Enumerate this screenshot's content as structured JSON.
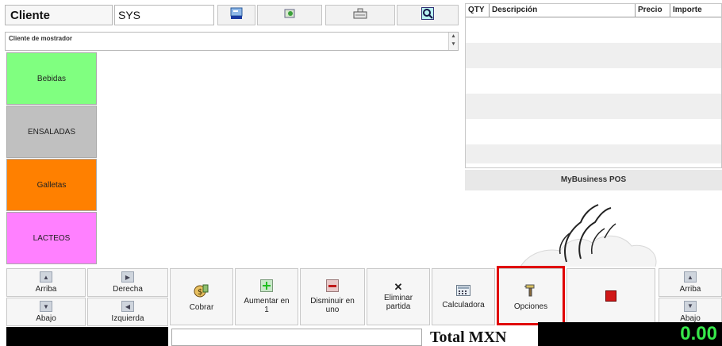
{
  "header": {
    "client_label": "Cliente",
    "client_code": "SYS",
    "client_name": "Cliente de mostrador",
    "icons": [
      "card-icon",
      "picture-icon",
      "keyboard-icon",
      "search-icon"
    ]
  },
  "categories": [
    {
      "label": "Bebidas",
      "color": "#80ff80"
    },
    {
      "label": "ENSALADAS",
      "color": "#c0c0c0"
    },
    {
      "label": "Galletas",
      "color": "#ff8000"
    },
    {
      "label": "LACTEOS",
      "color": "#ff80ff"
    }
  ],
  "order": {
    "headers": {
      "qty": "QTY",
      "desc": "Descripción",
      "price": "Precio",
      "amount": "Importe"
    }
  },
  "brand": {
    "title": "MyBusiness POS"
  },
  "toolbar": {
    "arriba_left": "Arriba",
    "abajo_left": "Abajo",
    "derecha": "Derecha",
    "izquierda": "Izquierda",
    "cobrar": "Cobrar",
    "aumentar_line1": "Aumentar en",
    "aumentar_line2": "1",
    "disminuir_line1": "Disminuir en",
    "disminuir_line2": "uno",
    "eliminar_line1": "Eliminar",
    "eliminar_line2": "partida",
    "calculadora": "Calculadora",
    "opciones": "Opciones",
    "arriba_right": "Arriba",
    "abajo_right": "Abajo"
  },
  "footer": {
    "total_label": "Total MXN",
    "total_value": "0.00"
  },
  "colors": {
    "total_text": "#37e84a",
    "highlight": "#e00000"
  }
}
